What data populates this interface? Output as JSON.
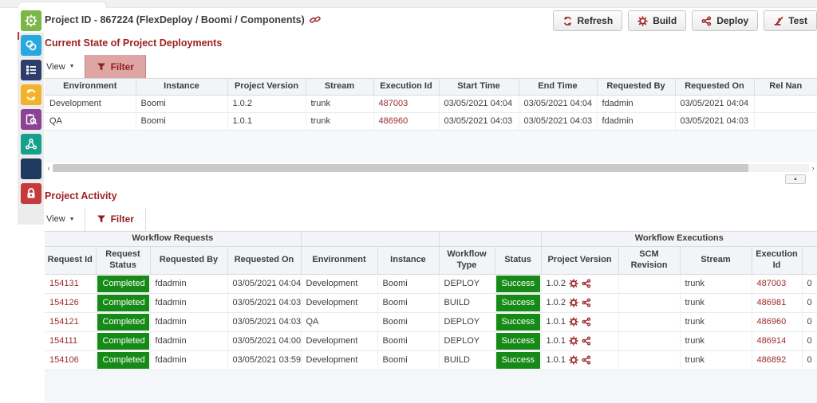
{
  "colors": {
    "accent_red": "#9c1f1f",
    "link_red": "#9c2c2c",
    "badge_green": "#168a16",
    "filter_active_bg": "#dfa4a4"
  },
  "sidebar": {
    "items": [
      {
        "icon": "gear-play-icon",
        "color": "#7ab648",
        "active": true
      },
      {
        "icon": "knot-icon",
        "color": "#29a8e0",
        "active": false
      },
      {
        "icon": "checklist-icon",
        "color": "#2d3e6b",
        "active": false
      },
      {
        "icon": "sync-icon",
        "color": "#f3b229",
        "active": false
      },
      {
        "icon": "clipboard-search-icon",
        "color": "#8d4393",
        "active": false
      },
      {
        "icon": "network-icon",
        "color": "#14a08d",
        "active": false
      },
      {
        "icon": "robot-arm-icon",
        "color": "#1f3a5f",
        "active": false
      },
      {
        "icon": "lock-icon",
        "color": "#c53b3b",
        "active": false
      }
    ]
  },
  "header": {
    "title": "Project ID - 867224 (FlexDeploy / Boomi / Components)",
    "link_icon": "link-icon",
    "buttons": [
      {
        "label": "Refresh",
        "icon": "refresh-icon"
      },
      {
        "label": "Build",
        "icon": "gear-icon"
      },
      {
        "label": "Deploy",
        "icon": "share-icon"
      },
      {
        "label": "Test",
        "icon": "robot-arm-icon"
      }
    ]
  },
  "deployments": {
    "title": "Current State of Project Deployments",
    "toolbar": {
      "view_label": "View",
      "filter_label": "Filter",
      "filter_active": true
    },
    "columns": [
      {
        "label": "Environment",
        "w": 114
      },
      {
        "label": "Instance",
        "w": 115
      },
      {
        "label": "Project Version",
        "w": 98
      },
      {
        "label": "Stream",
        "w": 85
      },
      {
        "label": "Execution Id",
        "w": 82,
        "type": "link"
      },
      {
        "label": "Start Time",
        "w": 100
      },
      {
        "label": "End Time",
        "w": 98
      },
      {
        "label": "Requested By",
        "w": 98
      },
      {
        "label": "Requested On",
        "w": 99
      },
      {
        "label": "Rel Nan",
        "w": 79
      }
    ],
    "rows": [
      [
        "Development",
        "Boomi",
        "1.0.2",
        "trunk",
        "487003",
        "03/05/2021 04:04",
        "03/05/2021 04:04",
        "fdadmin",
        "03/05/2021 04:04",
        ""
      ],
      [
        "QA",
        "Boomi",
        "1.0.1",
        "trunk",
        "486960",
        "03/05/2021 04:03",
        "03/05/2021 04:03",
        "fdadmin",
        "03/05/2021 04:03",
        ""
      ]
    ],
    "scrollbar": {
      "left_arrow": "‹",
      "right_arrow": "›",
      "collapse_icon": "▲"
    }
  },
  "activity": {
    "title": "Project Activity",
    "toolbar": {
      "view_label": "View",
      "filter_label": "Filter",
      "filter_active": false
    },
    "groups": [
      {
        "label": "Workflow Requests",
        "span": 4
      },
      {
        "label": "",
        "span": 2
      },
      {
        "label": "",
        "span": 2
      },
      {
        "label": "Workflow Executions",
        "span": 5
      }
    ],
    "columns": [
      {
        "label": "Request Id",
        "w": 64,
        "type": "link"
      },
      {
        "label": "Request Status",
        "w": 68,
        "type": "badge"
      },
      {
        "label": "Requested By",
        "w": 97
      },
      {
        "label": "Requested On",
        "w": 92
      },
      {
        "label": "Environment",
        "w": 96
      },
      {
        "label": "Instance",
        "w": 77
      },
      {
        "label": "Workflow Type",
        "w": 70
      },
      {
        "label": "Status",
        "w": 58,
        "type": "badge"
      },
      {
        "label": "Project Version",
        "w": 97,
        "type": "version"
      },
      {
        "label": "SCM Revision",
        "w": 77
      },
      {
        "label": "Stream",
        "w": 90
      },
      {
        "label": "Execution Id",
        "w": 63,
        "type": "link"
      },
      {
        "label": "",
        "w": 19
      }
    ],
    "rows": [
      [
        "154131",
        "Completed",
        "fdadmin",
        "03/05/2021 04:04",
        "Development",
        "Boomi",
        "DEPLOY",
        "Success",
        "1.0.2",
        "",
        "trunk",
        "487003",
        "0"
      ],
      [
        "154126",
        "Completed",
        "fdadmin",
        "03/05/2021 04:03",
        "Development",
        "Boomi",
        "BUILD",
        "Success",
        "1.0.2",
        "",
        "trunk",
        "486981",
        "0"
      ],
      [
        "154121",
        "Completed",
        "fdadmin",
        "03/05/2021 04:03",
        "QA",
        "Boomi",
        "DEPLOY",
        "Success",
        "1.0.1",
        "",
        "trunk",
        "486960",
        "0"
      ],
      [
        "154111",
        "Completed",
        "fdadmin",
        "03/05/2021 04:00",
        "Development",
        "Boomi",
        "DEPLOY",
        "Success",
        "1.0.1",
        "",
        "trunk",
        "486914",
        "0"
      ],
      [
        "154106",
        "Completed",
        "fdadmin",
        "03/05/2021 03:59",
        "Development",
        "Boomi",
        "BUILD",
        "Success",
        "1.0.1",
        "",
        "trunk",
        "486892",
        "0"
      ]
    ]
  }
}
